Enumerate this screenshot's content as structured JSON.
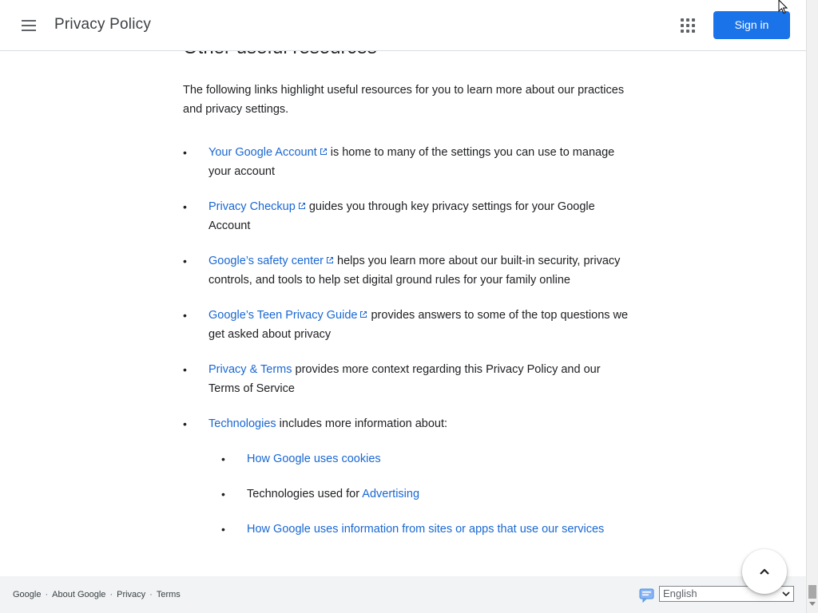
{
  "header": {
    "title": "Privacy Policy",
    "signin_label": "Sign in",
    "menu_icon": "hamburger-menu-icon",
    "apps_icon": "google-apps-grid-icon"
  },
  "content": {
    "section_title": "Other useful resources",
    "intro": "The following links highlight useful resources for you to learn more about our practices and privacy settings.",
    "items": [
      {
        "link": "Your Google Account",
        "external": true,
        "text": " is home to many of the settings you can use to manage your account"
      },
      {
        "link": "Privacy Checkup",
        "external": true,
        "text": " guides you through key privacy settings for your Google Account"
      },
      {
        "link": "Google’s safety center",
        "external": true,
        "text": " helps you learn more about our built-in security, privacy controls, and tools to help set digital ground rules for your family online"
      },
      {
        "link": "Google’s Teen Privacy Guide",
        "external": true,
        "text": " provides answers to some of the top questions we get asked about privacy"
      },
      {
        "link": "Privacy & Terms",
        "external": false,
        "text": " provides more context regarding this Privacy Policy and our Terms of Service"
      },
      {
        "link": "Technologies",
        "external": false,
        "text": " includes more information about:"
      }
    ],
    "sub_items": [
      {
        "prefix": "",
        "link": "How Google uses cookies"
      },
      {
        "prefix": "Technologies used for ",
        "link": "Advertising"
      },
      {
        "prefix": "",
        "link": "How Google uses information from sites or apps that use our services"
      }
    ]
  },
  "footer": {
    "links": [
      "Google",
      "About Google",
      "Privacy",
      "Terms"
    ],
    "separator": "·",
    "language": "English"
  },
  "colors": {
    "accent": "#1a73e8",
    "link": "#1967d2",
    "footer_bg": "#f1f3f4"
  }
}
